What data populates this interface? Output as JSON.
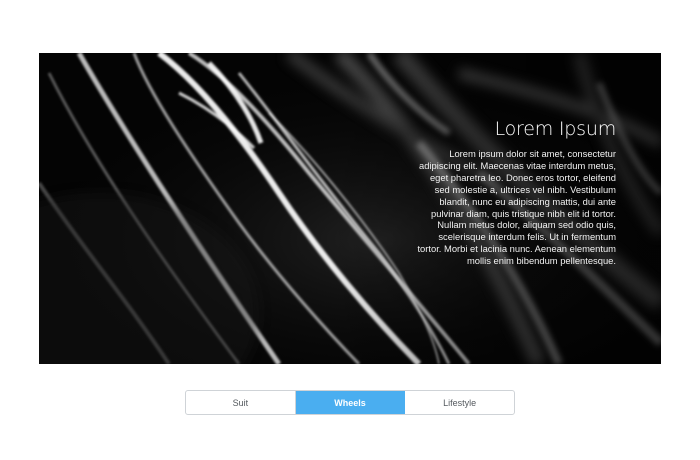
{
  "hero": {
    "title": "Lorem Ipsum",
    "body": "Lorem ipsum dolor sit amet, consectetur adipiscing elit. Maecenas vitae interdum metus, eget pharetra leo. Donec eros tortor, eleifend sed molestie a, ultrices vel nibh. Vestibulum blandit, nunc eu adipiscing mattis, dui ante pulvinar diam, quis tristique nibh elit id tortor. Nullam metus dolor, aliquam sed odio quis, scelerisque interdum felis. Ut in fermentum tortor. Morbi et lacinia nunc. Aenean elementum mollis enim bibendum pellentesque."
  },
  "tabs": [
    {
      "label": "Suit",
      "active": false
    },
    {
      "label": "Wheels",
      "active": true
    },
    {
      "label": "Lifestyle",
      "active": false
    }
  ],
  "colors": {
    "accent": "#4aaef0",
    "hero_background": "#050505",
    "tab_border": "#cfd3d7",
    "tab_text": "#555a5f"
  }
}
